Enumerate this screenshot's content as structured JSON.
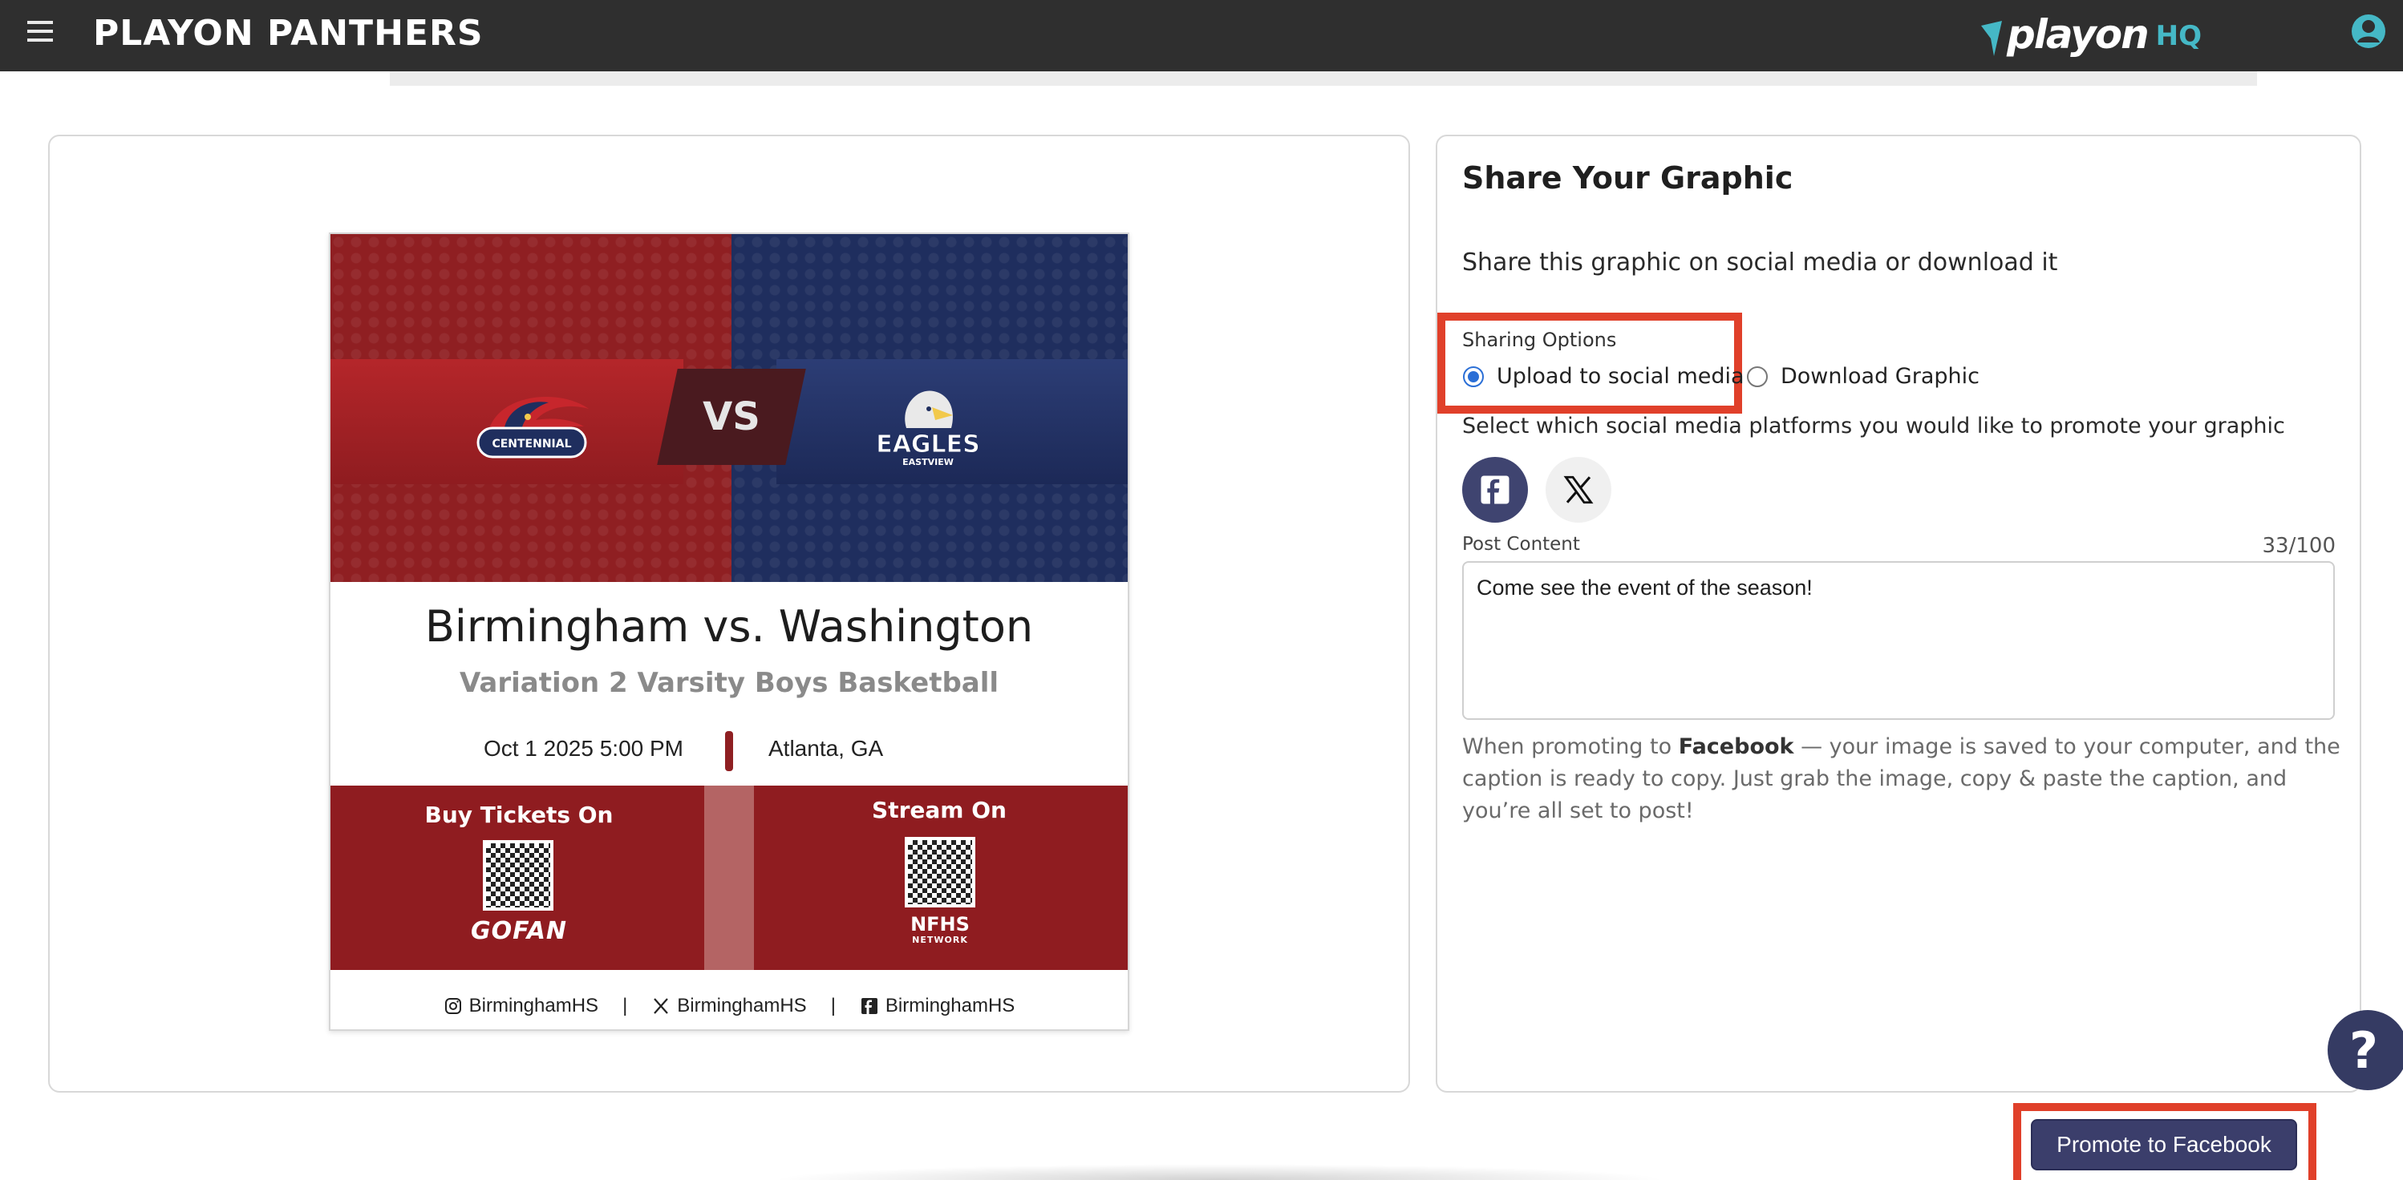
{
  "header": {
    "org_name": "PLAYON PANTHERS",
    "brand_word": "playon",
    "brand_suffix": "HQ",
    "colors": {
      "bar": "#2f2f2f",
      "accent": "#45b8c6"
    }
  },
  "graphic": {
    "vs": "VS",
    "home_logo_text": "CENTENNIAL",
    "away_logo_text": "EAGLES",
    "away_logo_subtext": "EASTVIEW",
    "matchup": "Birmingham vs. Washington",
    "variation": "Variation 2 Varsity Boys Basketball",
    "datetime": "Oct 1 2025 5:00 PM",
    "location": "Atlanta, GA",
    "tickets_label": "Buy Tickets On",
    "tickets_brand": "GOFAN",
    "stream_label": "Stream On",
    "stream_brand": "NFHS",
    "stream_brand_sub": "NETWORK",
    "socials": [
      {
        "icon": "instagram-icon",
        "handle": "BirminghamHS"
      },
      {
        "icon": "x-icon",
        "handle": "BirminghamHS"
      },
      {
        "icon": "facebook-icon",
        "handle": "BirminghamHS"
      }
    ],
    "separator": "|",
    "colors": {
      "home": "#8f1f22",
      "away": "#1f2e5e"
    }
  },
  "share": {
    "title": "Share Your Graphic",
    "description": "Share this graphic on social media or download it",
    "options_label": "Sharing Options",
    "option_upload": "Upload to social media",
    "option_download": "Download Graphic",
    "selected_option": "Upload to social media",
    "platform_prompt": "Select which social media platforms you would like to promote your graphic",
    "platforms": [
      {
        "icon": "facebook-icon",
        "selected": true
      },
      {
        "icon": "x-icon",
        "selected": false
      }
    ],
    "post_label": "Post Content",
    "char_count": "33/100",
    "post_content": "Come see the event of the season!",
    "note_prefix": "When promoting to ",
    "note_platform": "Facebook",
    "note_suffix": " — your image is saved to your computer, and the caption is ready to copy. Just grab the image, copy & paste the caption, and you’re all set to post!",
    "promote_button": "Promote to Facebook",
    "help": "?",
    "colors": {
      "primary": "#3b3e6b",
      "highlight": "#e0402a",
      "radio": "#2b6fd6"
    }
  }
}
